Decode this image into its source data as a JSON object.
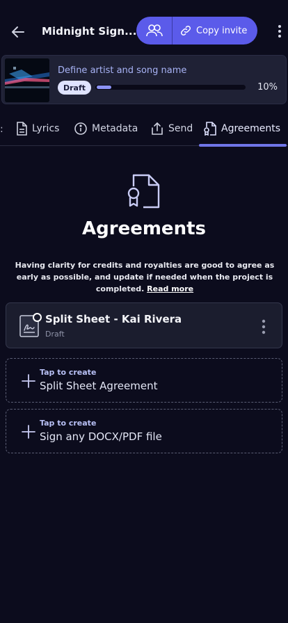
{
  "header": {
    "title": "Midnight Sign...",
    "copy_invite_label": "Copy invite"
  },
  "project": {
    "name": "Define artist and song name",
    "status": "Draft",
    "progress_percent": 10,
    "progress_label": "10%"
  },
  "tabs": [
    {
      "label": "Lyrics",
      "icon": "document-icon"
    },
    {
      "label": "Metadata",
      "icon": "info-icon"
    },
    {
      "label": "Send",
      "icon": "share-icon"
    },
    {
      "label": "Agreements",
      "icon": "agreement-icon",
      "active": true
    }
  ],
  "tab_overflow_glyph": ":",
  "hero": {
    "title": "Agreements",
    "description": "Having clarity for credits and royalties are good to agree as early as possible, and update if needed when the project is completed.",
    "link_label": "Read more"
  },
  "agreements": [
    {
      "title": "Split Sheet - Kai Rivera",
      "status": "Draft"
    }
  ],
  "create_options": [
    {
      "hint": "Tap to create",
      "label": "Split Sheet Agreement"
    },
    {
      "hint": "Tap to create",
      "label": "Sign any DOCX/PDF file"
    }
  ],
  "colors": {
    "background": "#0c0c1d",
    "accent": "#5b5bea",
    "progress_fill": "#8c93f5",
    "tab_underline": "#7076e8"
  }
}
